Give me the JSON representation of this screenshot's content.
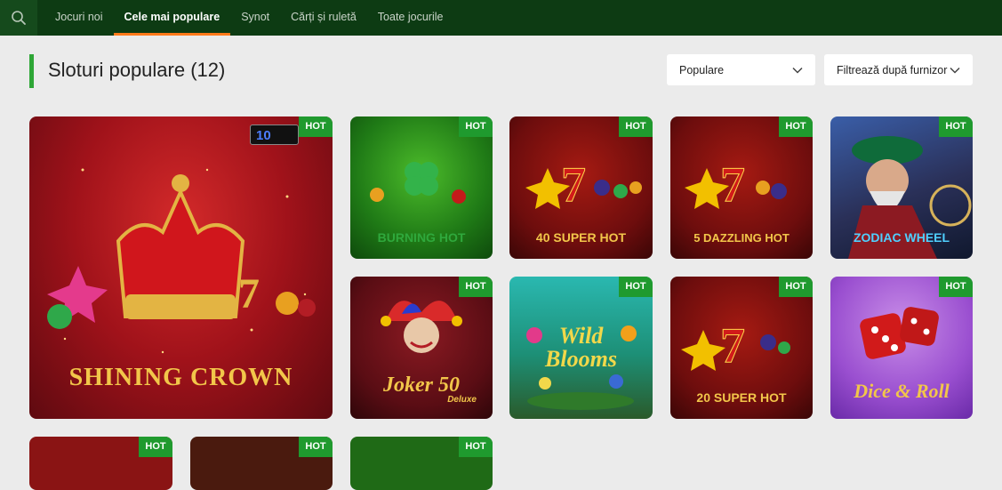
{
  "nav": {
    "items": [
      {
        "label": "Jocuri noi"
      },
      {
        "label": "Cele mai populare"
      },
      {
        "label": "Synot"
      },
      {
        "label": "Cărți și ruletă"
      },
      {
        "label": "Toate jocurile"
      }
    ]
  },
  "header": {
    "title": "Sloturi populare (12)",
    "sort_select": {
      "value": "Populare"
    },
    "provider_select": {
      "value": "Filtrează după furnizor"
    }
  },
  "badge_label": "HOT",
  "games": [
    {
      "title": "SHINING CROWN",
      "counter": "10"
    },
    {
      "title": "BURNING HOT"
    },
    {
      "title": "40 SUPER HOT"
    },
    {
      "title": "5 DAZZLING HOT"
    },
    {
      "title": "ZODIAC WHEEL"
    },
    {
      "title": "Joker 50",
      "subtitle": "Deluxe"
    },
    {
      "title": "Wild Blooms"
    },
    {
      "title": "20 SUPER HOT"
    },
    {
      "title": "Dice & Roll"
    }
  ],
  "colors": {
    "topbar": "#0d3b13",
    "accent_underline": "#ff7a1a",
    "hot_badge": "#1f9a2e",
    "title_marker": "#2ea636",
    "page_bg": "#ebebeb"
  }
}
